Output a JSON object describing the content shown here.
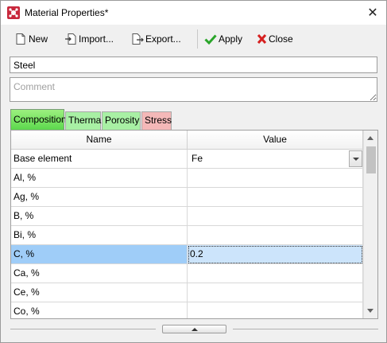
{
  "window": {
    "title": "Material Properties*",
    "icon": "material-app-icon",
    "close_icon": "close-icon"
  },
  "toolbar": {
    "new_label": "New",
    "import_label": "Import...",
    "export_label": "Export...",
    "apply_label": "Apply",
    "close_label": "Close",
    "icons": [
      "new-document-icon",
      "import-icon",
      "export-icon",
      "checkmark-icon",
      "red-x-icon"
    ]
  },
  "material": {
    "name": "Steel",
    "comment_placeholder": "Comment"
  },
  "tabs": [
    {
      "label": "Composition",
      "active": true,
      "color": "#5cd84d"
    },
    {
      "label": "Thermal",
      "active": false,
      "color": "#a8f0a4"
    },
    {
      "label": "Porosity",
      "active": false,
      "color": "#a8f0a4"
    },
    {
      "label": "Stress",
      "active": false,
      "color": "#f4b8b8"
    }
  ],
  "table": {
    "columns": [
      "Name",
      "Value"
    ],
    "rows": [
      {
        "name": "Base element",
        "value": "Fe"
      },
      {
        "name": "Al, %",
        "value": ""
      },
      {
        "name": "Ag, %",
        "value": ""
      },
      {
        "name": "B, %",
        "value": ""
      },
      {
        "name": "Bi, %",
        "value": ""
      },
      {
        "name": "C, %",
        "value": "0.2"
      },
      {
        "name": "Ca, %",
        "value": ""
      },
      {
        "name": "Ce, %",
        "value": ""
      },
      {
        "name": "Co, %",
        "value": ""
      }
    ],
    "selected_row": "C, %"
  },
  "colors": {
    "selection_name": "#9fcdf8",
    "selection_value": "#cce4fb",
    "apply_check": "#2aa52a",
    "close_x": "#d62020"
  }
}
